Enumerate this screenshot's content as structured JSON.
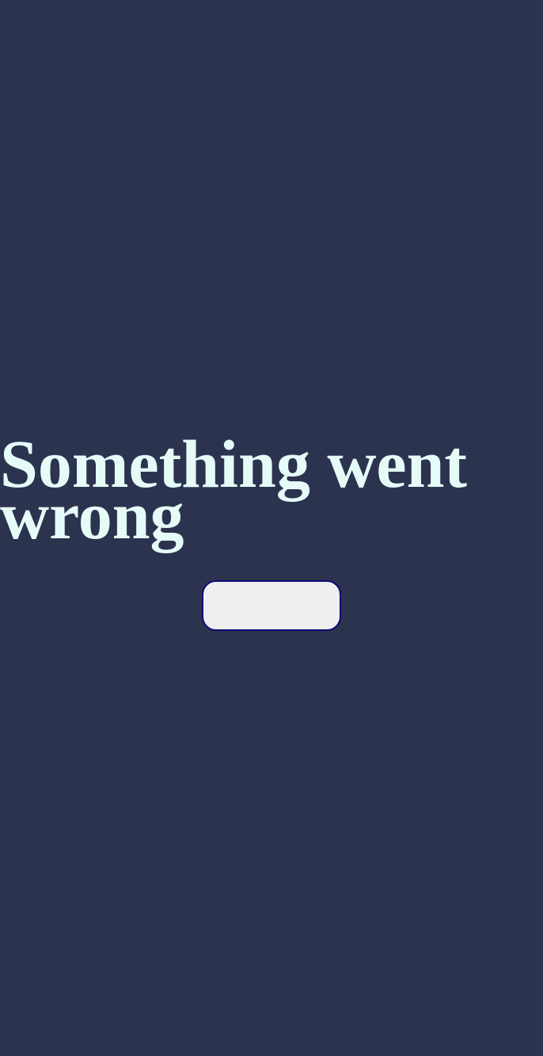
{
  "error": {
    "title": "Something went wrong"
  },
  "actions": {
    "button_label": ""
  },
  "colors": {
    "background": "#2c334f",
    "title": "#e6fbf8",
    "button_fill": "#efefef",
    "button_border": "#0b0b7a"
  }
}
